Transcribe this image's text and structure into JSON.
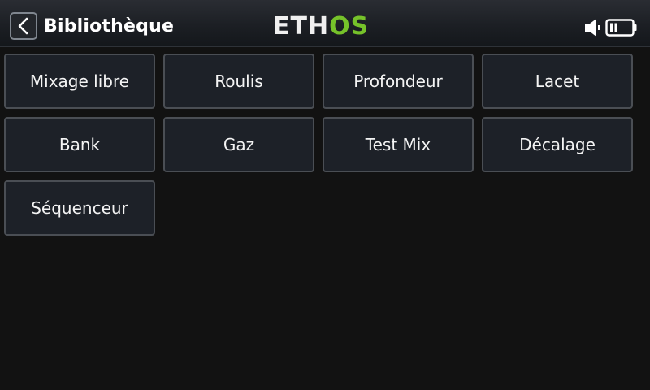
{
  "header": {
    "title": "Bibliothèque",
    "logo_part1": "ETH",
    "logo_part2": "OS",
    "back_icon": "chevron-left-icon",
    "speaker_icon": "speaker-icon",
    "battery_icon": "battery-icon"
  },
  "colors": {
    "background": "#121212",
    "tile_background": "#1d2128",
    "tile_border": "#4a4e54",
    "logo_accent": "#76c22a"
  },
  "grid": {
    "items": [
      {
        "label": "Mixage libre"
      },
      {
        "label": "Roulis"
      },
      {
        "label": "Profondeur"
      },
      {
        "label": "Lacet"
      },
      {
        "label": "Bank"
      },
      {
        "label": "Gaz"
      },
      {
        "label": "Test Mix"
      },
      {
        "label": "Décalage"
      },
      {
        "label": "Séquenceur"
      }
    ]
  }
}
